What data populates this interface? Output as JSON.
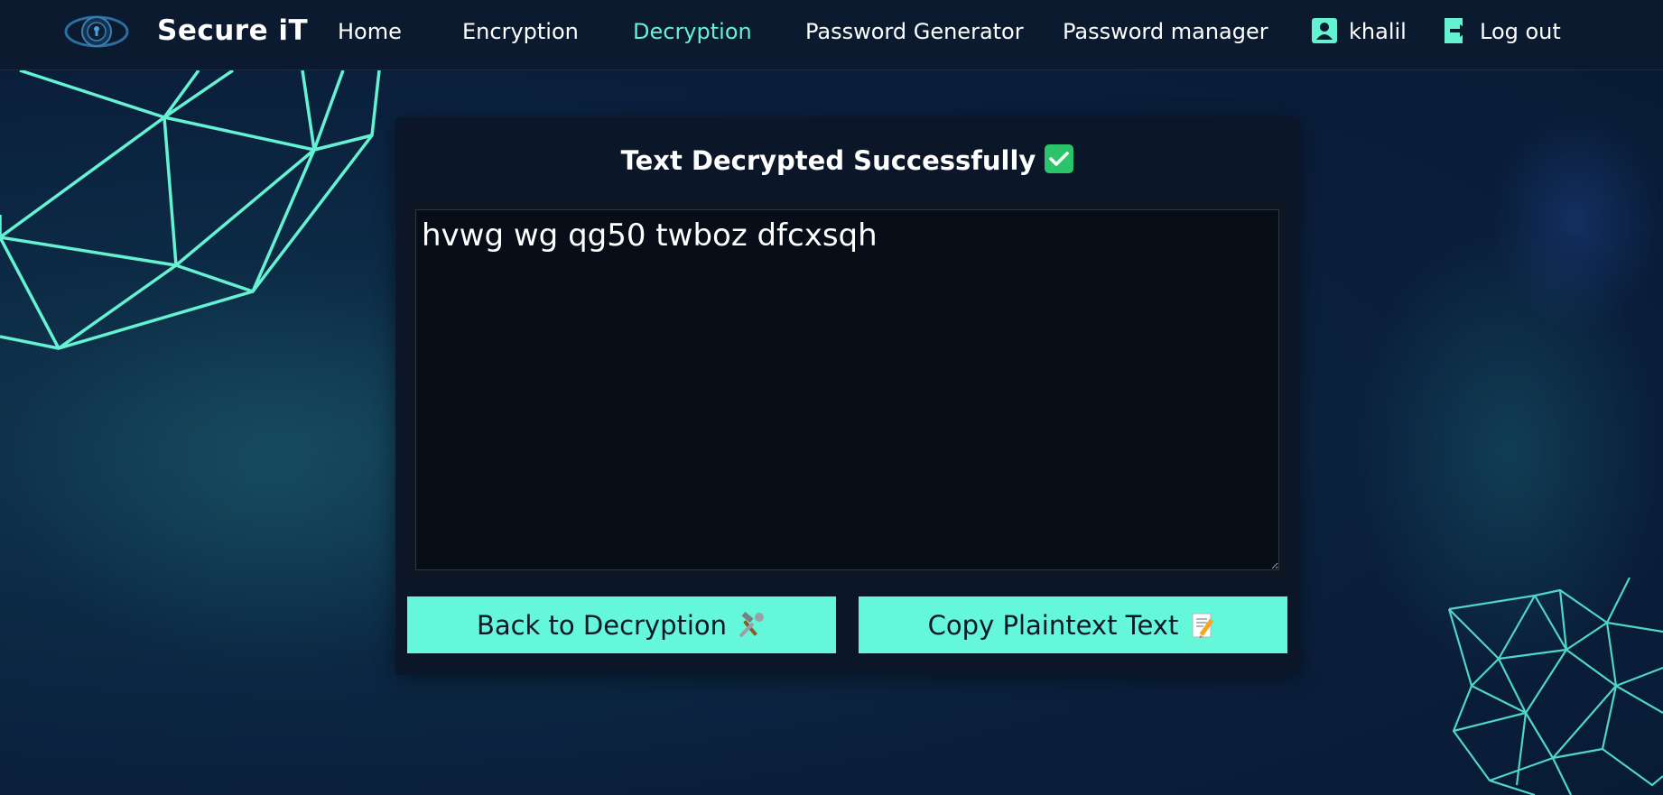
{
  "brand": {
    "name": "Secure iT",
    "logo_icon": "eye-keyhole-logo-icon"
  },
  "nav": {
    "items": [
      {
        "label": "Home"
      },
      {
        "label": "Encryption"
      },
      {
        "label": "Decryption",
        "active": true
      },
      {
        "label": "Password Generator"
      },
      {
        "label": "Password manager"
      }
    ],
    "user": {
      "label": "khalil",
      "icon": "user-profile-icon"
    },
    "logout": {
      "label": "Log out",
      "icon": "logout-arrow-icon"
    }
  },
  "card": {
    "title": "Text Decrypted Successfully",
    "title_icon": "check-mark-icon",
    "output_text": "hvwg wg qg50 twboz dfcxsqh",
    "back_button": {
      "label": "Back to Decryption",
      "icon": "hammer-wrench-icon"
    },
    "copy_button": {
      "label": "Copy Plaintext Text",
      "icon": "memo-pencil-icon"
    }
  },
  "colors": {
    "accent": "#64f7da",
    "active_nav": "#64f2d3",
    "navbar_bg": "#0b1a2f",
    "card_bg": "#0b1728",
    "check_green": "#2bc46b"
  }
}
